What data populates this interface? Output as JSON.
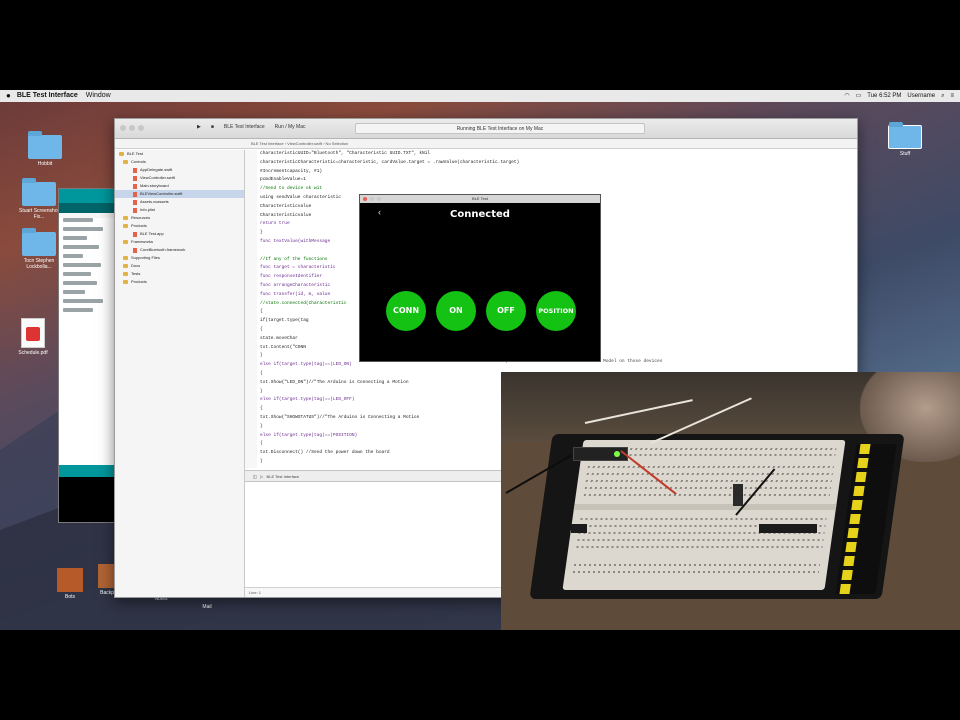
{
  "menubar": {
    "apple": "",
    "app_name": "BLE Test Interface",
    "menu_window": "Window",
    "right_clock": "Tue 6:52 PM",
    "right_user": "Username"
  },
  "desktop": {
    "left_icons": [
      "Hobbit",
      "Stuart Screenshot Fix...",
      "Tocn Stephen Lockbolla..."
    ],
    "right_icon": "Stuff",
    "document_icon": "Schedule.pdf",
    "dock_labels": [
      "Bots",
      "Backpack",
      "Notes",
      "Mail"
    ]
  },
  "xcode": {
    "toolbar_tabs": [
      "BLE Test Interface",
      "Run / My Mac"
    ],
    "status": "Running BLE Test Interface on My Mac",
    "jumpbar": "BLE Test Interface › ViewController.swift › No Selection",
    "navigator": [
      {
        "label": "BLE Test",
        "type": "project",
        "selected": false
      },
      {
        "label": "Controls",
        "type": "folder",
        "selected": false
      },
      {
        "label": "AppDelegate.swift",
        "type": "swift",
        "selected": false
      },
      {
        "label": "ViewController.swift",
        "type": "swift",
        "selected": false
      },
      {
        "label": "Main.storyboard",
        "type": "swift",
        "selected": false
      },
      {
        "label": "BLEViewController.swift",
        "type": "swift",
        "selected": true
      },
      {
        "label": "Assets.xcassets",
        "type": "swift",
        "selected": false
      },
      {
        "label": "Info.plist",
        "type": "swift",
        "selected": false
      },
      {
        "label": "Resources",
        "type": "folder",
        "selected": false
      },
      {
        "label": "Products",
        "type": "folder",
        "selected": false
      },
      {
        "label": "BLE Test.app",
        "type": "swift",
        "selected": false
      },
      {
        "label": "Frameworks",
        "type": "folder",
        "selected": false
      },
      {
        "label": "CoreBluetooth.framework",
        "type": "swift",
        "selected": false
      },
      {
        "label": "Supporting Files",
        "type": "folder",
        "selected": false
      },
      {
        "label": "Docs",
        "type": "folder",
        "selected": false
      },
      {
        "label": "Tests",
        "type": "folder",
        "selected": false
      },
      {
        "label": "Products",
        "type": "folder",
        "selected": false
      }
    ],
    "code_lines": [
      "    characteristicUUID=\"Bluetooth\", \"Characteristic UUID.TXT\", kNil",
      "    characteristicCharacteristic=characteristic, cardValue.target = .rawValue(characteristic.target)",
      "    #Incrementcapacity, #1)",
      "    pcmdEnableValue=1",
      "    //Send to device ok wit",
      "    using sendValue characteristic",
      "    Characteristicvalue",
      "    Characteristicvalue",
      "    return true",
      "  }",
      "  func textValue(withMessage",
      "",
      "    //If any of the functions",
      "    func target = characteristic",
      "    func responseIdentifier",
      "    func arrangeCharacteristic",
      "    func transfer(id, m, value",
      "    //state.connected(Characteristic",
      "  {",
      "    if(target.type(tag",
      "    {",
      "      state.moveChar",
      "      txt.Content(\"CONN",
      "    }",
      "    else if(target.type(tag)==(LED_ON)",
      "    {",
      "      txt.Show(\"LED_ON\")//\"The Arduino is Connecting a Motion",
      "    }",
      "    else if(target.type(tag)==(LED_OFF)",
      "    {",
      "      txt.Show(\"SHOWSTATUS\")//\"The Arduino is Connecting a Motion",
      "    }",
      "    else if(target.type(tag)==(POSITION)",
      "    {",
      "      txt.Disconnect() //Send the power down the board",
      "    }"
    ],
    "code_note": "CONN, POSITION or OFF to the default TD Model on those devices",
    "debug_label": "BLE Test Interface",
    "line_info": "Line: 1"
  },
  "simulator": {
    "window_title": "BLE Test",
    "status": "Connected",
    "back": "‹",
    "buttons": [
      "CONN",
      "ON",
      "OFF",
      "POSITION"
    ]
  },
  "colors": {
    "button_green": "#13c213",
    "sim_background": "#000000",
    "arduino_teal": "#00979c"
  }
}
